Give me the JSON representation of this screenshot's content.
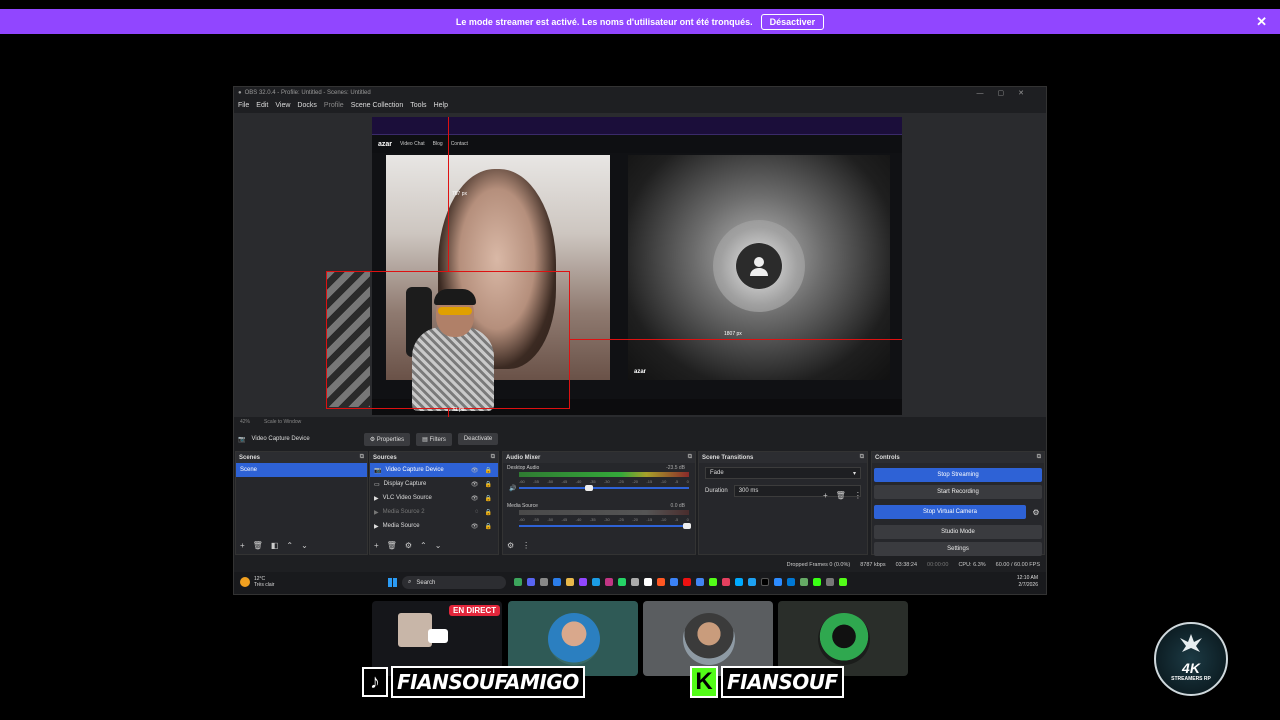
{
  "banner": {
    "message": "Le mode streamer est activé. Les noms d'utilisateur ont été tronqués.",
    "button": "Désactiver"
  },
  "obs": {
    "title": "OBS 32.0.4 - Profile: Untitled - Scenes: Untitled",
    "menu": [
      "File",
      "Edit",
      "View",
      "Docks",
      "Profile",
      "Scene Collection",
      "Tools",
      "Help"
    ],
    "preview": {
      "measure_top": "767 px",
      "measure_right": "1807 px",
      "measure_bottom": "31 px",
      "azar_logo": "azar",
      "azar_tabs": [
        "Video Chat",
        "Blog",
        "Contact"
      ],
      "azar_footer_logo": "azar"
    },
    "scale": {
      "zoom": "42%",
      "mode": "Scale to Window"
    },
    "source_toolbar": {
      "selected": "Video Capture Device",
      "properties": "Properties",
      "filters": "Filters",
      "deactivate": "Deactivate"
    },
    "scenes": {
      "header": "Scenes",
      "items": [
        "Scene"
      ]
    },
    "sources": {
      "header": "Sources",
      "items": [
        {
          "label": "Video Capture Device",
          "selected": true,
          "visible": true
        },
        {
          "label": "Display Capture",
          "selected": false,
          "visible": true
        },
        {
          "label": "VLC Video Source",
          "selected": false,
          "visible": true
        },
        {
          "label": "Media Source 2",
          "selected": false,
          "visible": false
        },
        {
          "label": "Media Source",
          "selected": false,
          "visible": true
        }
      ]
    },
    "mixer": {
      "header": "Audio Mixer",
      "channels": [
        {
          "name": "Desktop Audio",
          "db": "-23.5 dB",
          "level": 0.78
        },
        {
          "name": "Media Source",
          "db": "0.0 dB",
          "level": 0.0
        }
      ],
      "ticks": [
        "-60",
        "-55",
        "-50",
        "-45",
        "-40",
        "-35",
        "-30",
        "-25",
        "-20",
        "-15",
        "-10",
        "-5",
        "0"
      ]
    },
    "transitions": {
      "header": "Scene Transitions",
      "selected": "Fade",
      "duration_label": "Duration",
      "duration_value": "300 ms"
    },
    "controls": {
      "header": "Controls",
      "stop_streaming": "Stop Streaming",
      "start_recording": "Start Recording",
      "stop_virtual_camera": "Stop Virtual Camera",
      "studio_mode": "Studio Mode",
      "settings": "Settings"
    },
    "status": {
      "dropped": "Dropped Frames 0 (0.0%)",
      "bitrate": "8787 kbps",
      "stream_time": "03:38:24",
      "rec_time": "00:00:00",
      "cpu": "CPU: 6.3%",
      "fps": "60.00 / 60.00 FPS"
    }
  },
  "taskbar": {
    "temp": "12°C",
    "weather": "Très clair",
    "search": "Search",
    "time": "12:10 AM",
    "date": "2/7/2026"
  },
  "stream_overlay": {
    "live_badge": "EN DIRECT",
    "tiktok_handle": "FIANSOUFAMIGO",
    "kick_handle": "FIANSOUF",
    "badge_big": "4K",
    "badge_small": "STREAMERS RP"
  },
  "colors": {
    "banner": "#9146ff",
    "obs_accent": "#2e62d6",
    "live": "#e3263b",
    "kick": "#53fc18"
  }
}
